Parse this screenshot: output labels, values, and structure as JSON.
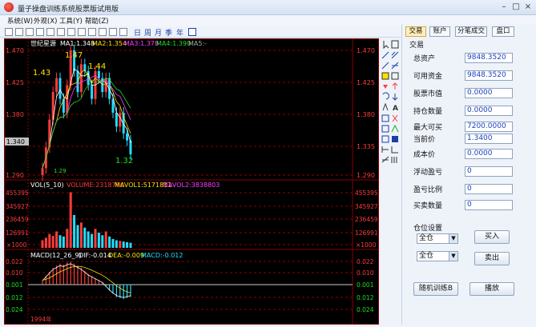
{
  "window": {
    "title": "量子操盘训练系统股票版试用版",
    "min": "–",
    "max": "□",
    "close": "×"
  },
  "menu": [
    "系统(W)",
    "外观(X)",
    "工具(Y)",
    "帮助(Z)"
  ],
  "periods": [
    "日",
    "周",
    "月",
    "季",
    "年"
  ],
  "chart": {
    "ma_title": "世纪星源",
    "ma_items": [
      {
        "label": "MA1:1.348",
        "color": "#ffffff"
      },
      {
        "label": "MA2:1.354",
        "color": "#ffe100"
      },
      {
        "label": "MA3:1.378",
        "color": "#ff3cff"
      },
      {
        "label": "MA4:1.390",
        "color": "#22dd22"
      },
      {
        "label": "MA5:-",
        "color": "#aaaaaa"
      }
    ],
    "price_ticks": [
      "1.470",
      "1.425",
      "1.380",
      "1.335",
      "1.290"
    ],
    "current_price": "1.340",
    "annotations": [
      "1.47",
      "1.44",
      "1.43",
      "1.32",
      "1.29"
    ],
    "vol_items": [
      {
        "label": "VOL(5_10)",
        "color": "#ffffff"
      },
      {
        "label": "VOLUME:2318766",
        "color": "#ff3c3c"
      },
      {
        "label": "MAVOL1:5171811",
        "color": "#ffe100"
      },
      {
        "label": "MAVOL2:3838803",
        "color": "#ff3cff"
      }
    ],
    "vol_ticks": [
      "455395",
      "345927",
      "236459",
      "126991"
    ],
    "unit": "×1000",
    "macd_items": [
      {
        "label": "MACD(12_26_9)",
        "color": "#ffffff"
      },
      {
        "label": "DIF:-0.014",
        "color": "#ffffff"
      },
      {
        "label": "DEA:-0.009",
        "color": "#ffe100"
      },
      {
        "label": "MACD:-0.012",
        "color": "#22ddff"
      }
    ],
    "macd_ticks": [
      "0.022",
      "0.010",
      "0.001",
      "0.012",
      "0.024"
    ],
    "date_label": "1994年"
  },
  "chart_data": {
    "type": "candlestick",
    "price_range": [
      1.29,
      1.47
    ],
    "close": [
      1.3,
      1.33,
      1.37,
      1.41,
      1.43,
      1.4,
      1.38,
      1.42,
      1.47,
      1.44,
      1.41,
      1.45,
      1.44,
      1.42,
      1.4,
      1.44,
      1.43,
      1.41,
      1.43,
      1.4,
      1.38,
      1.36,
      1.38,
      1.35,
      1.34,
      1.32
    ],
    "volume_range": [
      0,
      455395
    ],
    "volume": [
      60,
      80,
      110,
      95,
      130,
      100,
      90,
      150,
      440,
      260,
      180,
      200,
      160,
      130,
      110,
      150,
      120,
      100,
      130,
      90,
      70,
      60,
      55,
      50,
      45,
      40
    ],
    "macd_range": [
      -0.024,
      0.022
    ],
    "macd": [
      0.004,
      0.008,
      0.012,
      0.016,
      0.018,
      0.02,
      0.019,
      0.021,
      0.022,
      0.02,
      0.018,
      0.016,
      0.013,
      0.01,
      0.008,
      0.006,
      0.004,
      0.002,
      -0.002,
      -0.006,
      -0.009,
      -0.012,
      -0.013,
      -0.014,
      -0.013,
      -0.012
    ]
  },
  "panel": {
    "tabs": [
      "交易",
      "账户",
      "分笔成交",
      "盘口"
    ],
    "section": "交易",
    "fields": [
      {
        "label": "总资产",
        "value": "9848.3520"
      },
      {
        "label": "可用资金",
        "value": "9848.3520"
      },
      {
        "label": "股票市值",
        "value": "0.0000"
      },
      {
        "label": "持仓数量",
        "value": "0.0000"
      },
      {
        "label": "最大可买",
        "value": "7200.0000"
      },
      {
        "label": "当前价",
        "value": "1.3400"
      },
      {
        "label": "成本价",
        "value": "0.0000"
      },
      {
        "label": "浮动盈亏",
        "value": "0"
      },
      {
        "label": "盈亏比例",
        "value": "0"
      },
      {
        "label": "买卖数量",
        "value": "0"
      }
    ],
    "position_label": "仓位设置",
    "buy_select": "全仓",
    "buy_button": "买入",
    "sell_select": "全仓",
    "sell_button": "卖出",
    "random_button": "随机训练B",
    "play_button": "播放"
  },
  "colors": {
    "grid": "#8b0000",
    "up": "#ff3c3c",
    "down": "#22ddff"
  }
}
